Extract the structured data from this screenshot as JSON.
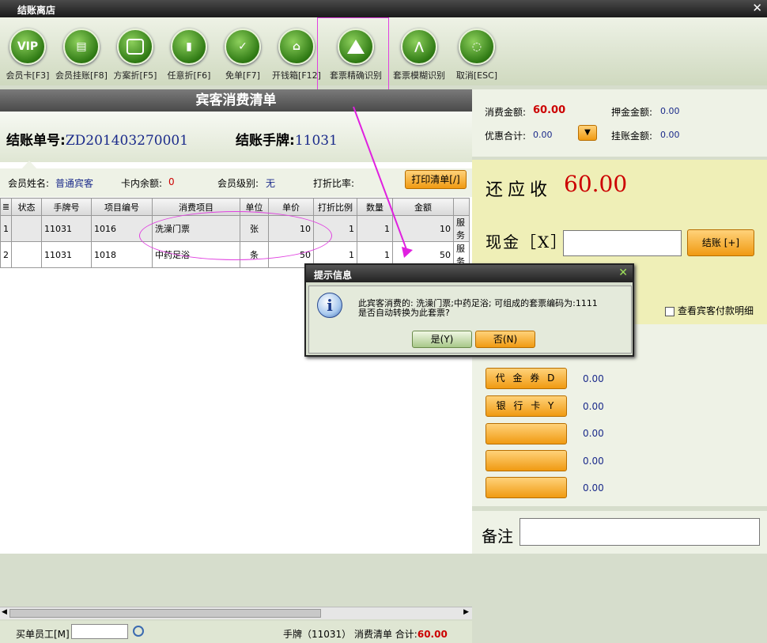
{
  "window": {
    "title": "结账离店",
    "close": "✕"
  },
  "toolbar": [
    {
      "label": "会员卡[F3]",
      "icon": "vip-icon",
      "glyph": "VIP"
    },
    {
      "label": "会员挂账[F8]",
      "icon": "member-credit-icon",
      "glyph": "▤"
    },
    {
      "label": "方案折[F5]",
      "icon": "plan-discount-icon",
      "glyph": ""
    },
    {
      "label": "任意折[F6]",
      "icon": "any-discount-icon",
      "glyph": "▮"
    },
    {
      "label": "免单[F7]",
      "icon": "free-bill-icon",
      "glyph": "✓"
    },
    {
      "label": "开钱箱[F12]",
      "icon": "cash-drawer-icon",
      "glyph": "⌂"
    },
    {
      "label": "套票精确识别",
      "icon": "ticket-exact-icon",
      "glyph": ""
    },
    {
      "label": "套票模糊识别",
      "icon": "ticket-fuzzy-icon",
      "glyph": "⋀"
    },
    {
      "label": "取消[ESC]",
      "icon": "cancel-icon",
      "glyph": "◌"
    }
  ],
  "bill": {
    "header": "宾客消费清单",
    "bill_no_label": "结账单号:",
    "bill_no": "ZD201403270001",
    "tag_label": "结账手牌:",
    "tag_no": "11031"
  },
  "member": {
    "name_label": "会员姓名:",
    "name": "普通宾客",
    "balance_label": "卡内余额:",
    "balance": "0",
    "level_label": "会员级别:",
    "level": "无",
    "discount_label": "打折比率:",
    "print_button": "打印清单[/]"
  },
  "table": {
    "columns": [
      "≣",
      "状态",
      "手牌号",
      "项目编号",
      "消费项目",
      "单位",
      "单价",
      "打折比例",
      "数量",
      "金额",
      ""
    ],
    "rows": [
      [
        "1",
        "",
        "11031",
        "1016",
        "洗澡门票",
        "张",
        "10",
        "1",
        "1",
        "10",
        "服务"
      ],
      [
        "2",
        "",
        "11031",
        "1018",
        "中药足浴",
        "条",
        "50",
        "1",
        "1",
        "50",
        "服务"
      ]
    ]
  },
  "footer": {
    "staff_label": "买单员工[M]",
    "summary_prefix": "手牌（11031） 消费清单 合计:",
    "total": "60.00"
  },
  "summary": {
    "consume_label": "消费金额:",
    "consume": "60.00",
    "deposit_label": "押金金额:",
    "deposit": "0.00",
    "discount_label": "优惠合计:",
    "discount": "0.00",
    "credit_label": "挂账金额:",
    "credit": "0.00"
  },
  "due": {
    "label": "还应收",
    "value": "60.00",
    "cash_label": "现金［X］",
    "settle_button": "结账 [+]",
    "check_label": "查看宾客付款明细"
  },
  "payments": [
    {
      "label": "",
      "value": ""
    },
    {
      "label": "代 金 券 D",
      "value": "0.00"
    },
    {
      "label": "银 行 卡 Y",
      "value": "0.00"
    },
    {
      "label": "",
      "value": "0.00"
    },
    {
      "label": "",
      "value": "0.00"
    },
    {
      "label": "",
      "value": "0.00"
    }
  ],
  "remark": {
    "label": "备注"
  },
  "dialog": {
    "title": "提示信息",
    "close": "✕",
    "line1": "此宾客消费的: 洗澡门票;中药足浴; 可组成的套票编码为:1111",
    "line2": "是否自动转换为此套票?",
    "yes": "是(Y)",
    "no": "否(N)"
  },
  "colors": {
    "accent_red": "#cc0000",
    "value_blue": "#1a2a8a",
    "button_orange": "#f09a12"
  }
}
